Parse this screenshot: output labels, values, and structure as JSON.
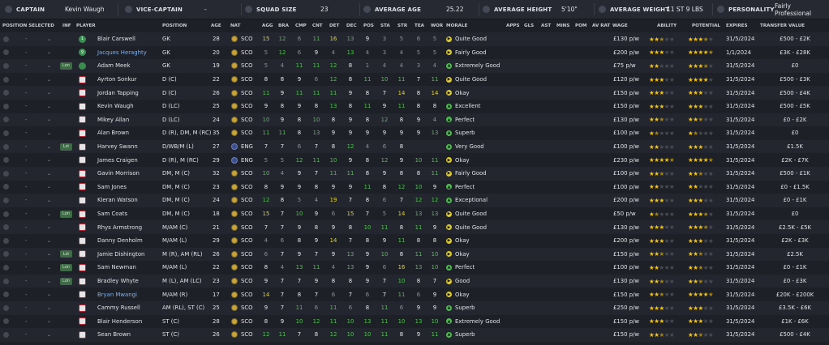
{
  "topbar": {
    "captain_label": "CAPTAIN",
    "captain_value": "Kevin Waugh",
    "vice_label": "VICE-CAPTAIN",
    "vice_value": "-",
    "squad_label": "SQUAD SIZE",
    "squad_value": "23",
    "age_label": "AVERAGE AGE",
    "age_value": "25.22",
    "height_label": "AVERAGE HEIGHT",
    "height_value": "5'10\"",
    "weight_label": "AVERAGE WEIGHT",
    "weight_value": "11 ST 9 LBS",
    "personality_label": "PERSONALITY",
    "personality_value": "Fairly Professional"
  },
  "headers": {
    "pos_sel": "POSITION SELECTED",
    "inf": "INF",
    "player": "PLAYER",
    "position": "POSITION",
    "age": "AGE",
    "nat": "NAT",
    "agg": "AGG",
    "bra": "BRA",
    "cmp": "CMP",
    "cnt": "CNT",
    "det": "DET",
    "dec": "DEC",
    "pos": "POS",
    "sta": "STA",
    "str": "STR",
    "tea": "TEA",
    "wor": "WOR",
    "morale": "MORALE",
    "apps": "APPS",
    "gls": "GLS",
    "ast": "AST",
    "mins": "MINS",
    "pom": "POM",
    "avrat": "AV RAT",
    "wage": "WAGE",
    "ability": "ABILITY",
    "potential": "POTENTIAL",
    "expires": "EXPIRES",
    "transfer": "TRANSFER VALUE"
  },
  "colors": {
    "good": "#4ec04e",
    "mid": "#ddd23b",
    "high": "#e9eaee",
    "low": "#8d9199",
    "star": "#f2c417",
    "accent_link": "#7fb0ea"
  },
  "players": [
    {
      "sel": "-",
      "inf": "",
      "num": "1",
      "shirt": "gk",
      "name": "Blair Carswell",
      "link": false,
      "position": "GK",
      "age": "28",
      "nat": "SCO",
      "a": [
        "15",
        "12",
        "6",
        "11",
        "16",
        "13",
        "9",
        "3",
        "5",
        "6",
        "5"
      ],
      "morale": "Quite Good",
      "mood": "y",
      "wage": "£130 p/w",
      "ability": 2.5,
      "potential": 3.5,
      "expires": "31/5/2024",
      "value": "£500 - £2K"
    },
    {
      "sel": "-",
      "inf": "",
      "num": "9",
      "shirt": "gk",
      "name": "Jacques Heraghty",
      "link": true,
      "position": "GK",
      "age": "20",
      "nat": "SCO",
      "a": [
        "5",
        "12",
        "6",
        "9",
        "4",
        "13",
        "4",
        "3",
        "4",
        "5",
        "5"
      ],
      "morale": "Fairly Good",
      "mood": "y",
      "wage": "£200 p/w",
      "ability": 3,
      "potential": 4.5,
      "expires": "1/1/2024",
      "value": "£3K - £28K"
    },
    {
      "sel": "-",
      "inf": "Lon",
      "num": "",
      "shirt": "gk",
      "name": "Adam Meek",
      "link": false,
      "position": "GK",
      "age": "19",
      "nat": "SCO",
      "a": [
        "5",
        "4",
        "11",
        "11",
        "12",
        "8",
        "1",
        "4",
        "4",
        "3",
        "4"
      ],
      "morale": "Extremely Good",
      "mood": "g",
      "wage": "£75 p/w",
      "ability": 2,
      "potential": 3.5,
      "expires": "31/5/2024",
      "value": "£0"
    },
    {
      "sel": "-",
      "inf": "",
      "num": "",
      "shirt": "out",
      "name": "Ayrton Sonkur",
      "link": false,
      "position": "D (C)",
      "age": "22",
      "nat": "SCO",
      "a": [
        "8",
        "8",
        "9",
        "6",
        "12",
        "8",
        "11",
        "10",
        "11",
        "7",
        "11"
      ],
      "morale": "Quite Good",
      "mood": "y",
      "wage": "£120 p/w",
      "ability": 3,
      "potential": 4,
      "expires": "31/5/2024",
      "value": "£500 - £3K"
    },
    {
      "sel": "-",
      "inf": "",
      "num": "",
      "shirt": "out",
      "name": "Jordan Tapping",
      "link": false,
      "position": "D (C)",
      "age": "26",
      "nat": "SCO",
      "a": [
        "11",
        "9",
        "11",
        "11",
        "11",
        "9",
        "8",
        "7",
        "14",
        "8",
        "14"
      ],
      "morale": "Okay",
      "mood": "y",
      "wage": "£150 p/w",
      "ability": 3,
      "potential": 3,
      "expires": "31/5/2024",
      "value": "£500 - £4K"
    },
    {
      "sel": "-",
      "inf": "",
      "num": "",
      "shirt": "out",
      "name": "Kevin Waugh",
      "link": false,
      "position": "D (LC)",
      "age": "25",
      "nat": "SCO",
      "a": [
        "9",
        "8",
        "9",
        "8",
        "13",
        "8",
        "11",
        "9",
        "11",
        "8",
        "8"
      ],
      "morale": "Excellent",
      "mood": "g",
      "wage": "£150 p/w",
      "ability": 3,
      "potential": 3,
      "expires": "31/5/2024",
      "value": "£500 - £5K"
    },
    {
      "sel": "-",
      "inf": "",
      "num": "",
      "shirt": "out",
      "name": "Mikey Allan",
      "link": false,
      "position": "D (LC)",
      "age": "24",
      "nat": "SCO",
      "a": [
        "10",
        "9",
        "8",
        "10",
        "8",
        "9",
        "8",
        "12",
        "8",
        "9",
        "4"
      ],
      "morale": "Perfect",
      "mood": "g",
      "wage": "£130 p/w",
      "ability": 2.5,
      "potential": 2.5,
      "expires": "31/5/2024",
      "value": "£0 - £2K"
    },
    {
      "sel": "-",
      "inf": "",
      "num": "",
      "shirt": "out",
      "name": "Alan Brown",
      "link": false,
      "position": "D (R), DM, M (RC)",
      "age": "35",
      "nat": "SCO",
      "a": [
        "11",
        "11",
        "8",
        "13",
        "9",
        "9",
        "9",
        "9",
        "9",
        "9",
        "13"
      ],
      "morale": "Superb",
      "mood": "g",
      "wage": "£100 p/w",
      "ability": 1.5,
      "potential": 1.5,
      "expires": "31/5/2024",
      "value": "£0"
    },
    {
      "sel": "-",
      "inf": "Lst",
      "num": "",
      "shirt": "out",
      "name": "Harvey Swann",
      "link": false,
      "position": "D/WB/M (L)",
      "age": "27",
      "nat": "ENG",
      "a": [
        "7",
        "7",
        "6",
        "7",
        "8",
        "12",
        "4",
        "6",
        "8",
        "",
        ""
      ],
      "morale": "Very Good",
      "mood": "g",
      "wage": "£100 p/w",
      "ability": 2,
      "potential": 3,
      "expires": "31/5/2024",
      "value": "£1.5K"
    },
    {
      "sel": "-",
      "inf": "",
      "num": "",
      "shirt": "out",
      "name": "James Craigen",
      "link": false,
      "position": "D (R), M (RC)",
      "age": "29",
      "nat": "ENG",
      "a": [
        "5",
        "5",
        "12",
        "11",
        "10",
        "9",
        "8",
        "12",
        "9",
        "10",
        "11"
      ],
      "morale": "Okay",
      "mood": "y",
      "wage": "£230 p/w",
      "ability": 4.5,
      "potential": 4.5,
      "expires": "31/5/2024",
      "value": "£2K - £7K"
    },
    {
      "sel": "-",
      "inf": "",
      "num": "",
      "shirt": "out",
      "name": "Gavin Morrison",
      "link": false,
      "position": "DM, M (C)",
      "age": "32",
      "nat": "SCO",
      "a": [
        "10",
        "4",
        "9",
        "7",
        "11",
        "11",
        "8",
        "9",
        "8",
        "8",
        "11"
      ],
      "morale": "Fairly Good",
      "mood": "y",
      "wage": "£100 p/w",
      "ability": 2.5,
      "potential": 2.5,
      "expires": "31/5/2024",
      "value": "£500 - £1K"
    },
    {
      "sel": "-",
      "inf": "",
      "num": "",
      "shirt": "out",
      "name": "Sam Jones",
      "link": false,
      "position": "DM, M (C)",
      "age": "23",
      "nat": "SCO",
      "a": [
        "8",
        "9",
        "9",
        "8",
        "9",
        "9",
        "11",
        "8",
        "12",
        "10",
        "9"
      ],
      "morale": "Perfect",
      "mood": "g",
      "wage": "£100 p/w",
      "ability": 2,
      "potential": 2,
      "expires": "31/5/2024",
      "value": "£0 - £1.5K"
    },
    {
      "sel": "-",
      "inf": "",
      "num": "",
      "shirt": "out",
      "name": "Kieran Watson",
      "link": false,
      "position": "DM, M (C)",
      "age": "24",
      "nat": "SCO",
      "a": [
        "12",
        "8",
        "5",
        "4",
        "19",
        "7",
        "8",
        "6",
        "7",
        "12",
        "12"
      ],
      "morale": "Exceptional",
      "mood": "g",
      "wage": "£200 p/w",
      "ability": 3,
      "potential": 3,
      "expires": "31/5/2024",
      "value": "£0 - £1K"
    },
    {
      "sel": "-",
      "inf": "Lon",
      "num": "",
      "shirt": "out",
      "name": "Sam Coats",
      "link": false,
      "position": "DM, M (C)",
      "age": "18",
      "nat": "SCO",
      "a": [
        "15",
        "7",
        "10",
        "9",
        "6",
        "15",
        "7",
        "5",
        "14",
        "13",
        "13"
      ],
      "morale": "Quite Good",
      "mood": "y",
      "wage": "£50 p/w",
      "ability": 1.5,
      "potential": 3.5,
      "potential_white": true,
      "expires": "31/5/2024",
      "value": "£0"
    },
    {
      "sel": "-",
      "inf": "",
      "num": "",
      "shirt": "out",
      "name": "Rhys Armstrong",
      "link": false,
      "position": "M/AM (C)",
      "age": "21",
      "nat": "SCO",
      "a": [
        "7",
        "7",
        "9",
        "8",
        "9",
        "8",
        "10",
        "11",
        "8",
        "11",
        "9"
      ],
      "morale": "Quite Good",
      "mood": "y",
      "wage": "£130 p/w",
      "ability": 3,
      "potential": 3.5,
      "expires": "31/5/2024",
      "value": "£2.5K - £5K"
    },
    {
      "sel": "-",
      "inf": "",
      "num": "",
      "shirt": "out",
      "name": "Danny Denholm",
      "link": false,
      "position": "M/AM (L)",
      "age": "29",
      "nat": "SCO",
      "a": [
        "4",
        "6",
        "8",
        "9",
        "14",
        "7",
        "8",
        "9",
        "11",
        "8",
        "8"
      ],
      "morale": "Okay",
      "mood": "y",
      "wage": "£200 p/w",
      "ability": 3,
      "potential": 3,
      "expires": "31/5/2024",
      "value": "£2K - £3K"
    },
    {
      "sel": "-",
      "inf": "Lst",
      "num": "",
      "shirt": "out",
      "name": "Jamie Dishington",
      "link": false,
      "position": "M (R), AM (RL)",
      "age": "26",
      "nat": "SCO",
      "a": [
        "6",
        "7",
        "9",
        "7",
        "9",
        "13",
        "9",
        "10",
        "8",
        "11",
        "10"
      ],
      "morale": "Okay",
      "mood": "y",
      "wage": "£150 p/w",
      "ability": 2.5,
      "potential": 2.5,
      "expires": "31/5/2024",
      "value": "£2.5K"
    },
    {
      "sel": "-",
      "inf": "Lon",
      "num": "",
      "shirt": "out",
      "name": "Sam Newman",
      "link": false,
      "position": "M/AM (L)",
      "age": "22",
      "nat": "SCO",
      "a": [
        "8",
        "4",
        "13",
        "11",
        "4",
        "13",
        "9",
        "6",
        "16",
        "13",
        "10"
      ],
      "morale": "Perfect",
      "mood": "g",
      "wage": "£100 p/w",
      "ability": 2,
      "potential": 2.5,
      "expires": "31/5/2024",
      "value": "£0 - £1K"
    },
    {
      "sel": "-",
      "inf": "Lon",
      "num": "",
      "shirt": "out",
      "name": "Bradley Whyte",
      "link": false,
      "position": "M (L), AM (LC)",
      "age": "23",
      "nat": "SCO",
      "a": [
        "9",
        "7",
        "7",
        "9",
        "8",
        "8",
        "9",
        "7",
        "10",
        "8",
        "7"
      ],
      "morale": "Good",
      "mood": "y",
      "wage": "£130 p/w",
      "ability": 2.5,
      "potential": 2.5,
      "expires": "31/5/2024",
      "value": "£0 - £3K"
    },
    {
      "sel": "-",
      "inf": "",
      "num": "",
      "shirt": "out",
      "name": "Bryan Mwangi",
      "link": true,
      "position": "M/AM (R)",
      "age": "17",
      "nat": "SCO",
      "a": [
        "14",
        "7",
        "8",
        "7",
        "6",
        "7",
        "6",
        "7",
        "11",
        "6",
        "9"
      ],
      "morale": "Okay",
      "mood": "y",
      "wage": "£150 p/w",
      "ability": 2.5,
      "potential": 4.5,
      "expires": "31/5/2024",
      "value": "£20K - £200K"
    },
    {
      "sel": "-",
      "inf": "",
      "num": "",
      "shirt": "out",
      "name": "Cammy Russell",
      "link": false,
      "position": "AM (RL), ST (C)",
      "age": "25",
      "nat": "SCO",
      "a": [
        "9",
        "7",
        "11",
        "6",
        "11",
        "6",
        "8",
        "11",
        "6",
        "9",
        "9"
      ],
      "morale": "Superb",
      "mood": "g",
      "wage": "£250 p/w",
      "ability": 3,
      "potential": 3,
      "expires": "31/5/2024",
      "value": "£3.5K - £6K"
    },
    {
      "sel": "-",
      "inf": "",
      "num": "",
      "shirt": "out",
      "name": "Blair Henderson",
      "link": false,
      "position": "ST (C)",
      "age": "28",
      "nat": "SCO",
      "a": [
        "8",
        "9",
        "10",
        "12",
        "11",
        "10",
        "13",
        "11",
        "10",
        "13",
        "10"
      ],
      "morale": "Extremely Good",
      "mood": "g",
      "wage": "£150 p/w",
      "ability": 3,
      "potential": 3,
      "expires": "31/5/2024",
      "value": "£1K - £6K"
    },
    {
      "sel": "-",
      "inf": "",
      "num": "",
      "shirt": "out",
      "name": "Sean Brown",
      "link": false,
      "position": "ST (C)",
      "age": "26",
      "nat": "SCO",
      "a": [
        "12",
        "11",
        "7",
        "8",
        "12",
        "10",
        "10",
        "11",
        "8",
        "9",
        "11"
      ],
      "morale": "Superb",
      "mood": "g",
      "wage": "£150 p/w",
      "ability": 2.5,
      "potential": 2.5,
      "expires": "31/5/2024",
      "value": "£500 - £4K"
    }
  ]
}
